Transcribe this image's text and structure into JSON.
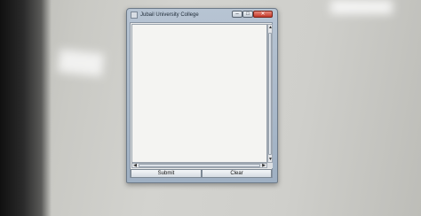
{
  "window": {
    "title": "Jubail University College",
    "controls": {
      "minimize": "–",
      "maximize": "□",
      "close": "✕"
    }
  },
  "textarea": {
    "value": ""
  },
  "scrollbar": {
    "up": "▲",
    "down": "▼",
    "left": "◀",
    "right": "▶"
  },
  "buttons": {
    "submit": "Submit",
    "clear": "Clear"
  },
  "icons": {
    "app": "java-cup-icon"
  }
}
